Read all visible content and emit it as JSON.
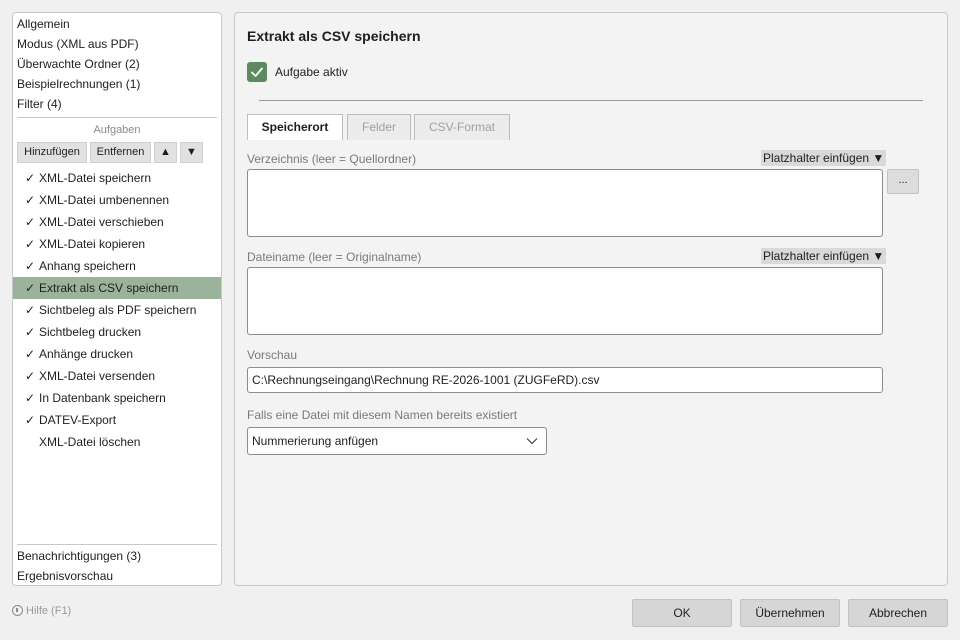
{
  "sidebar": {
    "nav_top": [
      "Allgemein",
      "Modus (XML aus PDF)",
      "Überwachte Ordner (2)",
      "Beispielrechnungen (1)",
      "Filter (4)"
    ],
    "tasks_heading": "Aufgaben",
    "add_label": "Hinzufügen",
    "remove_label": "Entfernen",
    "up_label": "▲",
    "down_label": "▼",
    "check_mark": "✓",
    "tasks": [
      {
        "label": "XML-Datei speichern",
        "checked": true
      },
      {
        "label": "XML-Datei umbenennen",
        "checked": true
      },
      {
        "label": "XML-Datei verschieben",
        "checked": true
      },
      {
        "label": "XML-Datei kopieren",
        "checked": true
      },
      {
        "label": "Anhang speichern",
        "checked": true
      },
      {
        "label": "Extrakt als CSV speichern",
        "checked": true,
        "selected": true
      },
      {
        "label": "Sichtbeleg als PDF speichern",
        "checked": true
      },
      {
        "label": "Sichtbeleg drucken",
        "checked": true
      },
      {
        "label": "Anhänge drucken",
        "checked": true
      },
      {
        "label": "XML-Datei versenden",
        "checked": true
      },
      {
        "label": "In Datenbank speichern",
        "checked": true
      },
      {
        "label": "DATEV-Export",
        "checked": true
      },
      {
        "label": "XML-Datei löschen",
        "checked": false
      }
    ],
    "nav_bottom": [
      "Benachrichtigungen (3)",
      "Ergebnisvorschau"
    ],
    "selected_color": "#9bb39b"
  },
  "main": {
    "title": "Extrakt als CSV speichern",
    "active_checkbox_label": "Aufgabe aktiv",
    "active_checked": true,
    "tabs": [
      {
        "label": "Speicherort",
        "active": true
      },
      {
        "label": "Felder",
        "active": false
      },
      {
        "label": "CSV-Format",
        "active": false
      }
    ],
    "directory_label": "Verzeichnis (leer = Quellordner)",
    "placeholder_button": "Platzhalter einfügen ▼",
    "browse_label": "...",
    "directory_value": "",
    "filename_label": "Dateiname (leer = Originalname)",
    "filename_value": "",
    "preview_label": "Vorschau",
    "preview_value": "C:\\Rechnungseingang\\Rechnung RE-2026-1001 (ZUGFeRD).csv",
    "exists_label": "Falls eine Datei mit diesem Namen bereits existiert",
    "exists_value": "Nummerierung anfügen",
    "accent_color": "#5f8a5f"
  },
  "footer": {
    "help_label": "Hilfe (F1)",
    "ok_label": "OK",
    "apply_label": "Übernehmen",
    "cancel_label": "Abbrechen"
  }
}
